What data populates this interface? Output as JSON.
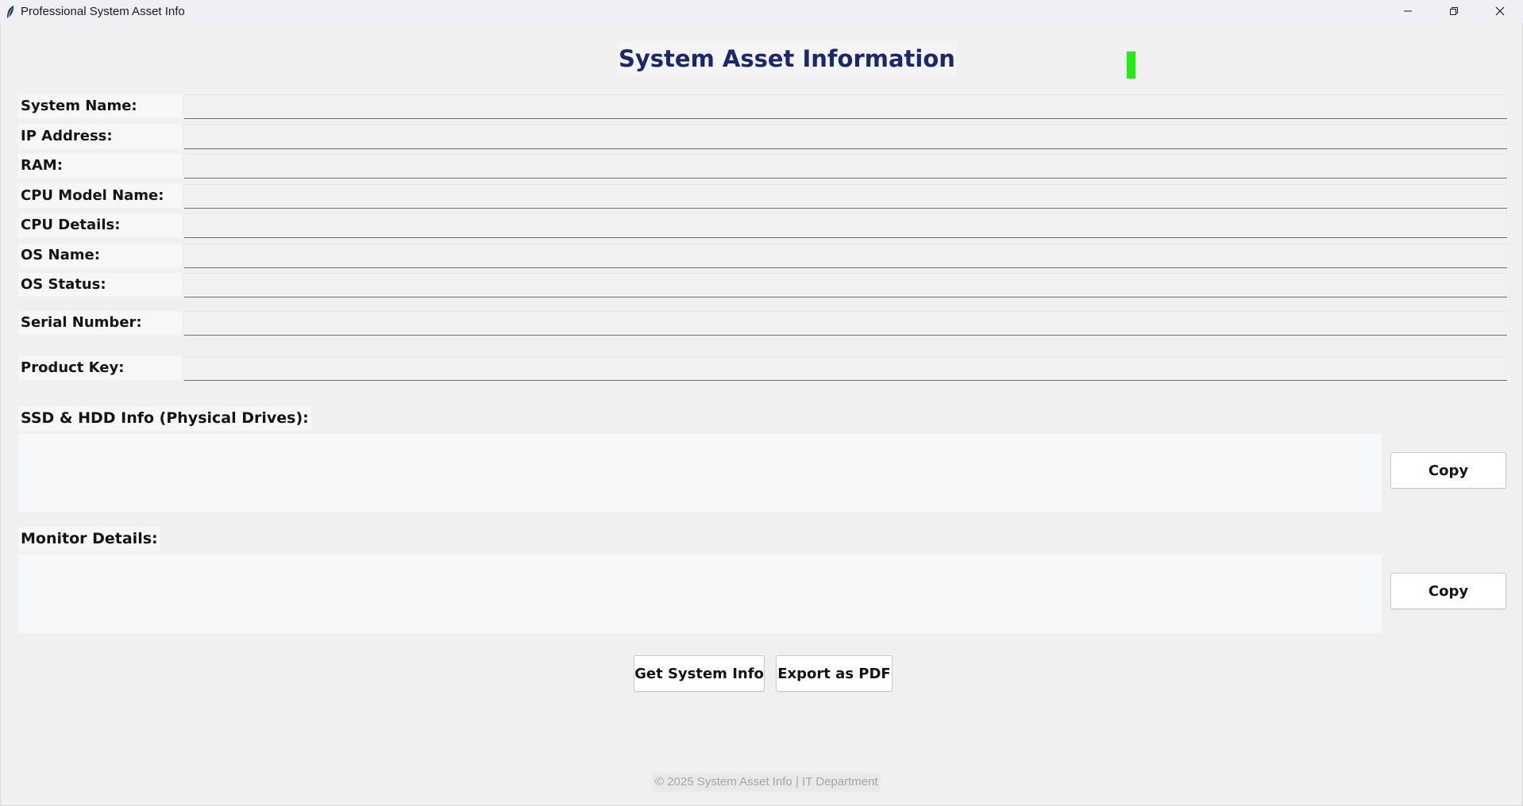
{
  "window": {
    "title": "Professional System Asset Info",
    "icon": "feather-icon",
    "controls": {
      "minimize": "minimize-icon",
      "restore": "restore-icon",
      "close": "close-icon"
    }
  },
  "header": {
    "title": "System Asset Information",
    "indicator_color": "#22ee0e",
    "title_color": "#1b2670"
  },
  "fields": {
    "system_name": {
      "label": "System Name:",
      "value": ""
    },
    "ip_address": {
      "label": "IP Address:",
      "value": ""
    },
    "ram": {
      "label": "RAM:",
      "value": ""
    },
    "cpu_model_name": {
      "label": "CPU Model Name:",
      "value": ""
    },
    "cpu_details": {
      "label": "CPU Details:",
      "value": ""
    },
    "os_name": {
      "label": "OS Name:",
      "value": ""
    },
    "os_status": {
      "label": "OS Status:",
      "value": ""
    },
    "serial_number": {
      "label": "Serial Number:",
      "value": ""
    },
    "product_key": {
      "label": "Product Key:",
      "value": ""
    }
  },
  "drives": {
    "label": "SSD & HDD Info (Physical Drives):",
    "content": "",
    "copy_label": "Copy"
  },
  "monitors": {
    "label": "Monitor Details:",
    "content": "",
    "copy_label": "Copy"
  },
  "actions": {
    "get_info_label": "Get System Info",
    "export_pdf_label": "Export as PDF"
  },
  "footer": {
    "text": "© 2025 System Asset Info | IT Department"
  }
}
